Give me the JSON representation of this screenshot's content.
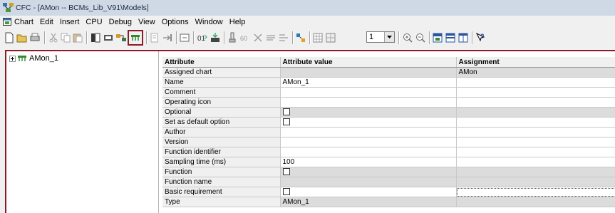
{
  "window": {
    "title": "CFC - [AMon -- BCMs_Lib_V91\\Models]"
  },
  "menu": [
    "Chart",
    "Edit",
    "Insert",
    "CPU",
    "Debug",
    "View",
    "Options",
    "Window",
    "Help"
  ],
  "toolbar": {
    "icons": [
      "new-icon",
      "open-icon",
      "print-icon",
      "cut-icon",
      "copy-icon",
      "paste-icon",
      "chart-overview-icon",
      "sheet-view-icon",
      "interconnect-icon",
      "block-type-icon",
      "block-icon",
      "connect-icon",
      "sequence-icon",
      "compile-icon",
      "download-icon",
      "test-mode-icon",
      "watch-icon",
      "run-icon",
      "check-icon",
      "relation-icon",
      "grid-icon",
      "grid-small-icon",
      "zoom-in-icon",
      "zoom-out-icon",
      "split-icon",
      "dynamic-display-icon",
      "catalog-icon",
      "help-icon"
    ],
    "zoom_value": "1",
    "highlight_color": "#8c1a2b"
  },
  "tree": {
    "root_label": "AMon_1"
  },
  "table": {
    "headers": {
      "attribute": "Attribute",
      "value": "Attribute value",
      "assignment": "Assignment"
    },
    "rows": [
      {
        "attr": "Assigned chart",
        "value": "",
        "assignment": "AMon",
        "value_checkbox": false,
        "grey": true
      },
      {
        "attr": "Name",
        "value": "AMon_1",
        "assignment": "",
        "value_checkbox": false,
        "grey": false
      },
      {
        "attr": "Comment",
        "value": "",
        "assignment": "",
        "value_checkbox": false,
        "grey": false
      },
      {
        "attr": "Operating icon",
        "value": "",
        "assignment": "",
        "value_checkbox": false,
        "grey": false
      },
      {
        "attr": "Optional",
        "value": "",
        "assignment": "",
        "value_checkbox": true,
        "grey": true
      },
      {
        "attr": "Set as default option",
        "value": "",
        "assignment": "",
        "value_checkbox": true,
        "grey": false
      },
      {
        "attr": "Author",
        "value": "",
        "assignment": "",
        "value_checkbox": false,
        "grey": false
      },
      {
        "attr": "Version",
        "value": "",
        "assignment": "",
        "value_checkbox": false,
        "grey": false
      },
      {
        "attr": "Function identifier",
        "value": "",
        "assignment": "",
        "value_checkbox": false,
        "grey": false
      },
      {
        "attr": "Sampling time (ms)",
        "value": "100",
        "assignment": "",
        "value_checkbox": false,
        "grey": false
      },
      {
        "attr": "Function",
        "value": "",
        "assignment": "",
        "value_checkbox": true,
        "grey": true
      },
      {
        "attr": "Function name",
        "value": "",
        "assignment": "",
        "value_checkbox": false,
        "grey": true
      },
      {
        "attr": "Basic requirement",
        "value": "",
        "assignment": "",
        "value_checkbox": true,
        "grey": false,
        "focus": true
      },
      {
        "attr": "Type",
        "value": "AMon_1",
        "assignment": "",
        "value_checkbox": false,
        "grey": true
      }
    ]
  }
}
